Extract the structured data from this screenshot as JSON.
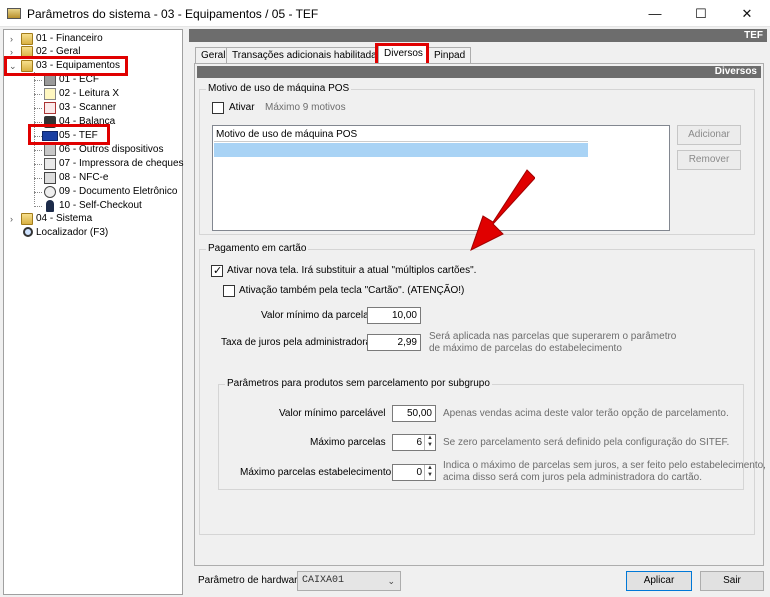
{
  "window": {
    "title": "Parâmetros do sistema - 03 - Equipamentos / 05 - TEF",
    "minimize": "—",
    "maximize": "☐",
    "close": "✕"
  },
  "tree": {
    "items": [
      {
        "label": "01 - Financeiro",
        "icon": "folder-icon"
      },
      {
        "label": "02 - Geral",
        "icon": "folder-icon"
      },
      {
        "label": "03 - Equipamentos",
        "icon": "folder-open-icon"
      },
      {
        "label": "01 - ECF",
        "icon": "printer-icon"
      },
      {
        "label": "02 - Leitura X",
        "icon": "document-icon"
      },
      {
        "label": "03 - Scanner",
        "icon": "scanner-icon"
      },
      {
        "label": "04 - Balança",
        "icon": "scale-icon"
      },
      {
        "label": "05 - TEF",
        "icon": "visa-card-icon"
      },
      {
        "label": "06 - Outros dispositivos",
        "icon": "devices-icon"
      },
      {
        "label": "07 - Impressora de cheques",
        "icon": "check-printer-icon"
      },
      {
        "label": "08 - NFC-e",
        "icon": "nfce-icon"
      },
      {
        "label": "09 - Documento Eletrônico",
        "icon": "globe-icon"
      },
      {
        "label": "10 - Self-Checkout",
        "icon": "person-icon"
      },
      {
        "label": "04 - Sistema",
        "icon": "folder-icon"
      },
      {
        "label": "Localizador (F3)",
        "icon": "magnifier-icon"
      }
    ]
  },
  "main": {
    "header": "TEF",
    "tabs": [
      {
        "label": "Geral"
      },
      {
        "label": "Transações adicionais habilitadas"
      },
      {
        "label": "Diversos"
      },
      {
        "label": "Pinpad"
      }
    ],
    "active_tab": "Diversos",
    "sub_header": "Diversos",
    "motivo": {
      "title": "Motivo de uso de máquina POS",
      "ativar_label": "Ativar",
      "ativar_checked": false,
      "max_hint": "Máximo 9 motivos",
      "list_header": "Motivo de uso de máquina POS",
      "add_button": "Adicionar",
      "remove_button": "Remover"
    },
    "pagamento": {
      "title": "Pagamento em cartão",
      "nova_tela_label": "Ativar nova tela. Irá substituir a atual \"múltiplos cartões\".",
      "nova_tela_checked": true,
      "tecla_cartao_label": "Ativação também pela tecla \"Cartão\". (ATENÇÃO!)",
      "tecla_cartao_checked": false,
      "valor_min_label": "Valor mínimo da parcela",
      "valor_min_value": "10,00",
      "taxa_label": "Taxa de juros pela administradora",
      "taxa_value": "2,99",
      "taxa_hint_1": "Será aplicada nas parcelas que superarem o parâmetro",
      "taxa_hint_2": "de máximo de parcelas do estabelecimento",
      "subgrupo": {
        "title": "Parâmetros para produtos sem parcelamento por subgrupo",
        "valor_min_label": "Valor mínimo parcelável",
        "valor_min_value": "50,00",
        "valor_min_hint": "Apenas vendas acima deste valor terão opção de parcelamento.",
        "max_parcelas_label": "Máximo parcelas",
        "max_parcelas_value": "6",
        "max_parcelas_hint": "Se zero parcelamento será definido pela configuração do SITEF.",
        "max_estab_label": "Máximo parcelas estabelecimento",
        "max_estab_value": "0",
        "max_estab_hint_1": "Indica o máximo de parcelas sem juros, a ser feito pelo estabelecimento,",
        "max_estab_hint_2": "acima disso será com juros pela administradora do cartão."
      }
    }
  },
  "bottom": {
    "hardware_label": "Parâmetro de hardware",
    "hardware_value": "CAIXA01",
    "apply_button": "Aplicar",
    "exit_button": "Sair"
  },
  "annotation_color": "#e00000"
}
